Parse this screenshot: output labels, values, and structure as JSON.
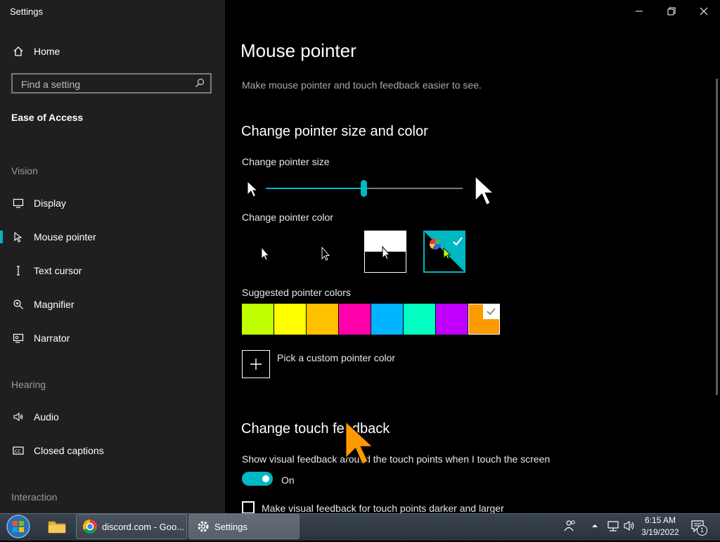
{
  "window": {
    "title": "Settings"
  },
  "sidebar": {
    "home_label": "Home",
    "search_placeholder": "Find a setting",
    "category": "Ease of Access",
    "sections": {
      "vision": "Vision",
      "hearing": "Hearing",
      "interaction": "Interaction"
    },
    "items": [
      {
        "label": "Display",
        "icon": "monitor-icon"
      },
      {
        "label": "Mouse pointer",
        "icon": "mouse-pointer-icon",
        "active": true
      },
      {
        "label": "Text cursor",
        "icon": "text-cursor-icon"
      },
      {
        "label": "Magnifier",
        "icon": "magnifier-icon"
      },
      {
        "label": "Narrator",
        "icon": "narrator-icon"
      },
      {
        "label": "Audio",
        "icon": "speaker-icon"
      },
      {
        "label": "Closed captions",
        "icon": "closed-captions-icon"
      }
    ]
  },
  "main": {
    "title": "Mouse pointer",
    "description": "Make mouse pointer and touch feedback easier to see.",
    "size_color_heading": "Change pointer size and color",
    "size_label": "Change pointer size",
    "size_level": 0.5,
    "color_label": "Change pointer color",
    "color_options": [
      "white",
      "black",
      "inverted",
      "custom"
    ],
    "selected_color_option": "custom",
    "suggested_label": "Suggested pointer colors",
    "suggested_colors": [
      "#bfff00",
      "#ffff00",
      "#ffc000",
      "#ff00aa",
      "#00b4ff",
      "#00ffc0",
      "#c000ff",
      "#ff9900"
    ],
    "selected_suggested_color": "#ff9900",
    "custom_color_label": "Pick a custom pointer color",
    "touch_heading": "Change touch feedback",
    "touch_feedback_label": "Show visual feedback around the touch points when I touch the screen",
    "toggle_state": "On",
    "darker_label": "Make visual feedback for touch points darker and larger"
  },
  "taskbar": {
    "items": [
      {
        "label": "discord.com - Goo...",
        "icon": "chrome-icon"
      },
      {
        "label": "Settings",
        "icon": "gear-icon"
      }
    ],
    "time": "6:15 AM",
    "date": "3/19/2022",
    "notification_count": "1"
  },
  "colors": {
    "accent": "#00b7c3",
    "pointer_custom": "#ff9900"
  }
}
